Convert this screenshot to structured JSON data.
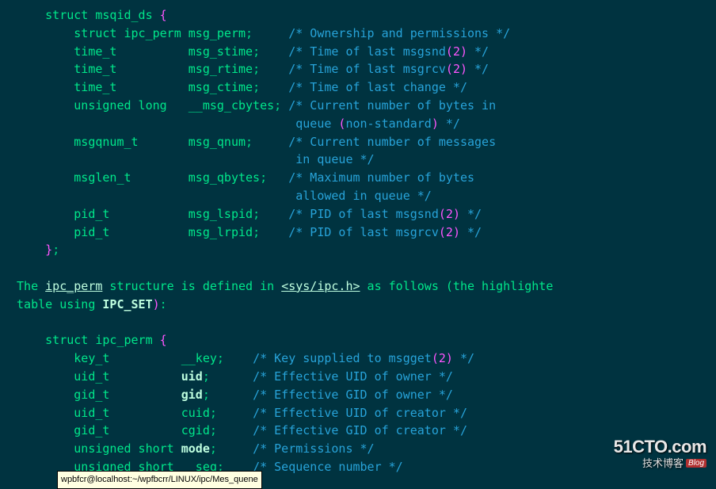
{
  "struct1": {
    "open": "     struct msqid_ds {",
    "lines": [
      {
        "ind": "         ",
        "type": "struct ipc_perm ",
        "member": "msg_perm",
        "post": ";     ",
        "comment": "/* Ownership and permissions */"
      },
      {
        "ind": "         ",
        "type": "time_t          ",
        "member": "msg_stime",
        "post": ";    ",
        "comment": "/* Time of last msgsnd(2) */"
      },
      {
        "ind": "         ",
        "type": "time_t          ",
        "member": "msg_rtime",
        "post": ";    ",
        "comment": "/* Time of last msgrcv(2) */"
      },
      {
        "ind": "         ",
        "type": "time_t          ",
        "member": "msg_ctime",
        "post": ";    ",
        "comment": "/* Time of last change */"
      },
      {
        "ind": "         ",
        "type": "unsigned long   ",
        "member": "__msg_cbytes",
        "post": "; ",
        "comment": "/* Current number of bytes in"
      },
      {
        "cont": true,
        "ind": "                                        ",
        "comment": "queue (non-standard) */"
      },
      {
        "ind": "         ",
        "type": "msgqnum_t       ",
        "member": "msg_qnum",
        "post": ";     ",
        "comment": "/* Current number of messages"
      },
      {
        "cont": true,
        "ind": "                                        ",
        "comment": "in queue */"
      },
      {
        "ind": "         ",
        "type": "msglen_t        ",
        "member": "msg_qbytes",
        "post": ";   ",
        "comment": "/* Maximum number of bytes"
      },
      {
        "cont": true,
        "ind": "                                        ",
        "comment": "allowed in queue */"
      },
      {
        "ind": "         ",
        "type": "pid_t           ",
        "member": "msg_lspid",
        "post": ";    ",
        "comment": "/* PID of last msgsnd(2) */"
      },
      {
        "ind": "         ",
        "type": "pid_t           ",
        "member": "msg_lrpid",
        "post": ";    ",
        "comment": "/* PID of last msgrcv(2) */"
      }
    ],
    "close": "     };"
  },
  "prose": {
    "p1a": " The ",
    "ipc_perm": "ipc_perm",
    "p1b": " structure is defined in ",
    "include": "<sys/ipc.h>",
    "p1c": " as follows (the highlighte",
    "p2a": " table using ",
    "ipc_set": "IPC_SET",
    "p2b": "):"
  },
  "struct2": {
    "open": "     struct ipc_perm {",
    "lines": [
      {
        "ind": "         ",
        "type": "key_t          ",
        "member": "__key",
        "bold": false,
        "post": ";    ",
        "comment": "/* Key supplied to msgget(2) */"
      },
      {
        "ind": "         ",
        "type": "uid_t          ",
        "member": "uid",
        "bold": true,
        "post": ";      ",
        "comment": "/* Effective UID of owner */"
      },
      {
        "ind": "         ",
        "type": "gid_t          ",
        "member": "gid",
        "bold": true,
        "post": ";      ",
        "comment": "/* Effective GID of owner */"
      },
      {
        "ind": "         ",
        "type": "uid_t          ",
        "member": "cuid",
        "bold": false,
        "post": ";     ",
        "comment": "/* Effective UID of creator */"
      },
      {
        "ind": "         ",
        "type": "gid_t          ",
        "member": "cgid",
        "bold": false,
        "post": ";     ",
        "comment": "/* Effective GID of creator */"
      },
      {
        "ind": "         ",
        "type": "unsigned short ",
        "member": "mode",
        "bold": true,
        "post": ";     ",
        "comment": "/* Permissions */"
      },
      {
        "ind": "         ",
        "type": "unsigned short ",
        "member": "__seq",
        "bold": false,
        "post": ";    ",
        "comment": "/* Sequence number */"
      }
    ]
  },
  "tooltip": "wpbfcr@localhost:~/wpfbcrr/LINUX/ipc/Mes_quene",
  "watermark": {
    "line1": "51CTO.com",
    "line2": "技术博客",
    "badge": "Blog"
  }
}
